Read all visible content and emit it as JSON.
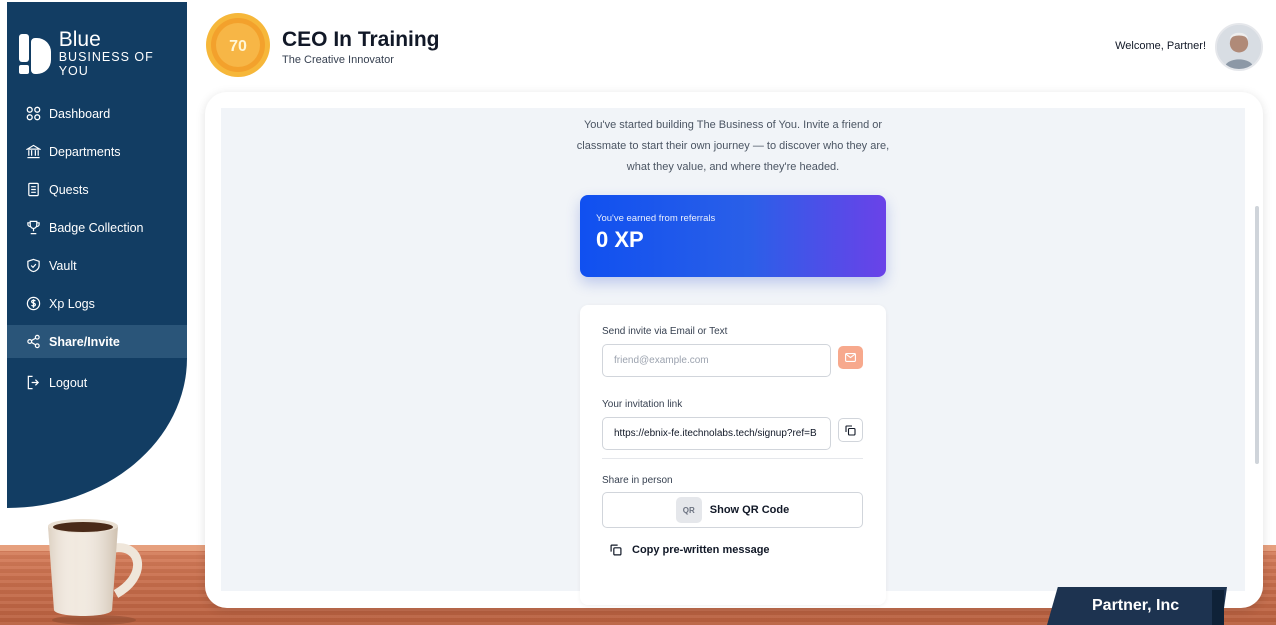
{
  "sidebar": {
    "brand": "Blue",
    "brand_sub": "BUSINESS OF YOU",
    "items": [
      {
        "label": "Dashboard",
        "icon": "grid-icon"
      },
      {
        "label": "Departments",
        "icon": "building-icon"
      },
      {
        "label": "Quests",
        "icon": "scroll-icon"
      },
      {
        "label": "Badge Collection",
        "icon": "trophy-icon"
      },
      {
        "label": "Vault",
        "icon": "shield-icon"
      },
      {
        "label": "Xp Logs",
        "icon": "dollar-circle-icon"
      },
      {
        "label": "Share/Invite",
        "icon": "share-icon",
        "active": true
      },
      {
        "label": "Logout",
        "icon": "logout-icon"
      }
    ]
  },
  "header": {
    "level": "70",
    "title": "CEO In Training",
    "subtitle": "The Creative Innovator",
    "welcome": "Welcome, Partner!"
  },
  "main": {
    "intro": "You've started building The Business of You. Invite a friend or classmate to start their own journey — to discover who they are, what they value, and where they're headed.",
    "xp_label": "You've earned from referrals",
    "xp_value": "0 XP",
    "email_label": "Send invite via Email or Text",
    "email_placeholder": "friend@example.com",
    "link_label": "Your invitation link",
    "link_value": "https://ebnix-fe.itechnolabs.tech/signup?ref=B",
    "share_label": "Share in person",
    "qr_badge": "QR",
    "qr_button": "Show QR Code",
    "copy_message": "Copy pre-written message"
  },
  "nameplate": "Partner, Inc",
  "colors": {
    "sidebar": "#123d63",
    "accent": "#1050f0",
    "mail_button": "#f7a98d"
  }
}
